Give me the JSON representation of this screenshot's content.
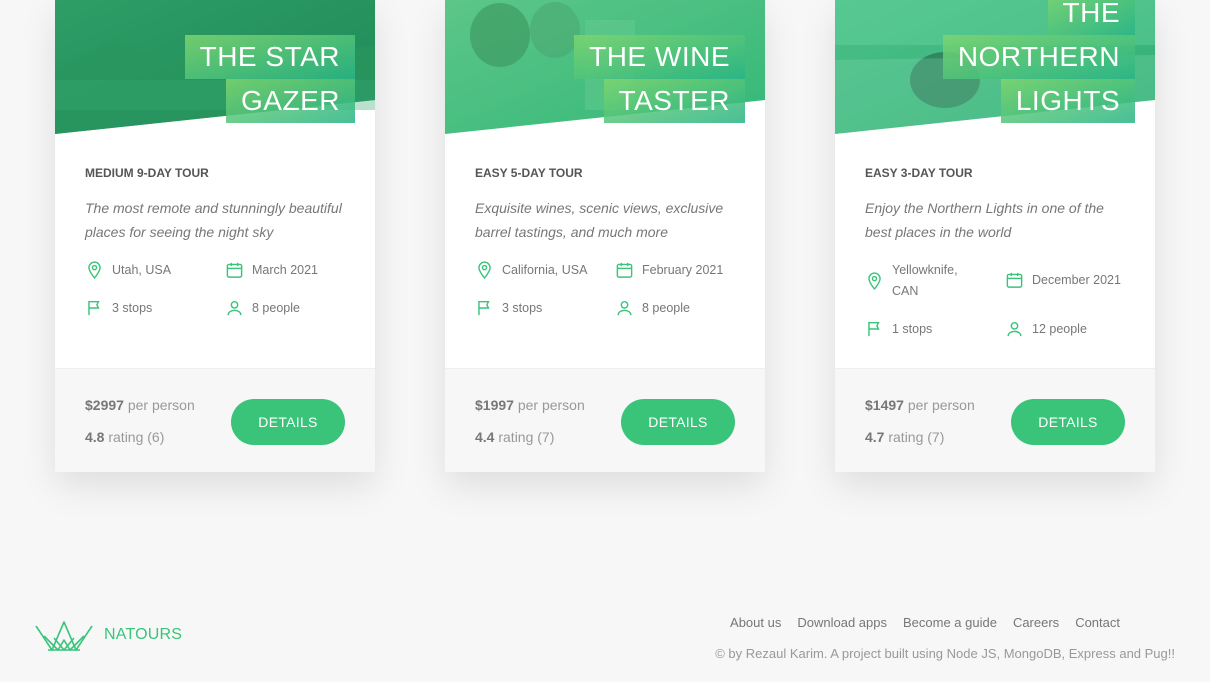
{
  "tours": [
    {
      "title_lines": [
        "THE STAR",
        "GAZER"
      ],
      "difficulty_duration": "MEDIUM 9-DAY TOUR",
      "summary": "The most remote and stunningly beautiful places for seeing the night sky",
      "location": "Utah, USA",
      "date": "March 2021",
      "stops": "3 stops",
      "people": "8 people",
      "price": "$2997",
      "price_unit": "per person",
      "rating": "4.8",
      "rating_text": "rating (6)",
      "button_label": "DETAILS"
    },
    {
      "title_lines": [
        "THE WINE",
        "TASTER"
      ],
      "difficulty_duration": "EASY 5-DAY TOUR",
      "summary": "Exquisite wines, scenic views, exclusive barrel tastings, and much more",
      "location": "California, USA",
      "date": "February 2021",
      "stops": "3 stops",
      "people": "8 people",
      "price": "$1997",
      "price_unit": "per person",
      "rating": "4.4",
      "rating_text": "rating (7)",
      "button_label": "DETAILS"
    },
    {
      "title_lines": [
        "THE",
        "NORTHERN",
        "LIGHTS"
      ],
      "difficulty_duration": "EASY 3-DAY TOUR",
      "summary": "Enjoy the Northern Lights in one of the best places in the world",
      "location_lines": [
        "Yellowknife,",
        "CAN"
      ],
      "date": "December 2021",
      "stops": "1 stops",
      "people": "12 people",
      "price": "$1497",
      "price_unit": "per person",
      "rating": "4.7",
      "rating_text": "rating (7)",
      "button_label": "DETAILS"
    }
  ],
  "footer": {
    "brand": "NATOURS",
    "nav": [
      "About us",
      "Download apps",
      "Become a guide",
      "Careers",
      "Contact"
    ],
    "copyright": "© by Rezaul Karim. A project built using Node JS, MongoDB, Express and Pug!!"
  },
  "colors": {
    "accent": "#39c47a",
    "gradient_light": "#7ed56f",
    "gradient_dark": "#28b485"
  },
  "icons": {
    "location": "map-pin-icon",
    "date": "calendar-icon",
    "stops": "flag-icon",
    "people": "user-icon"
  }
}
